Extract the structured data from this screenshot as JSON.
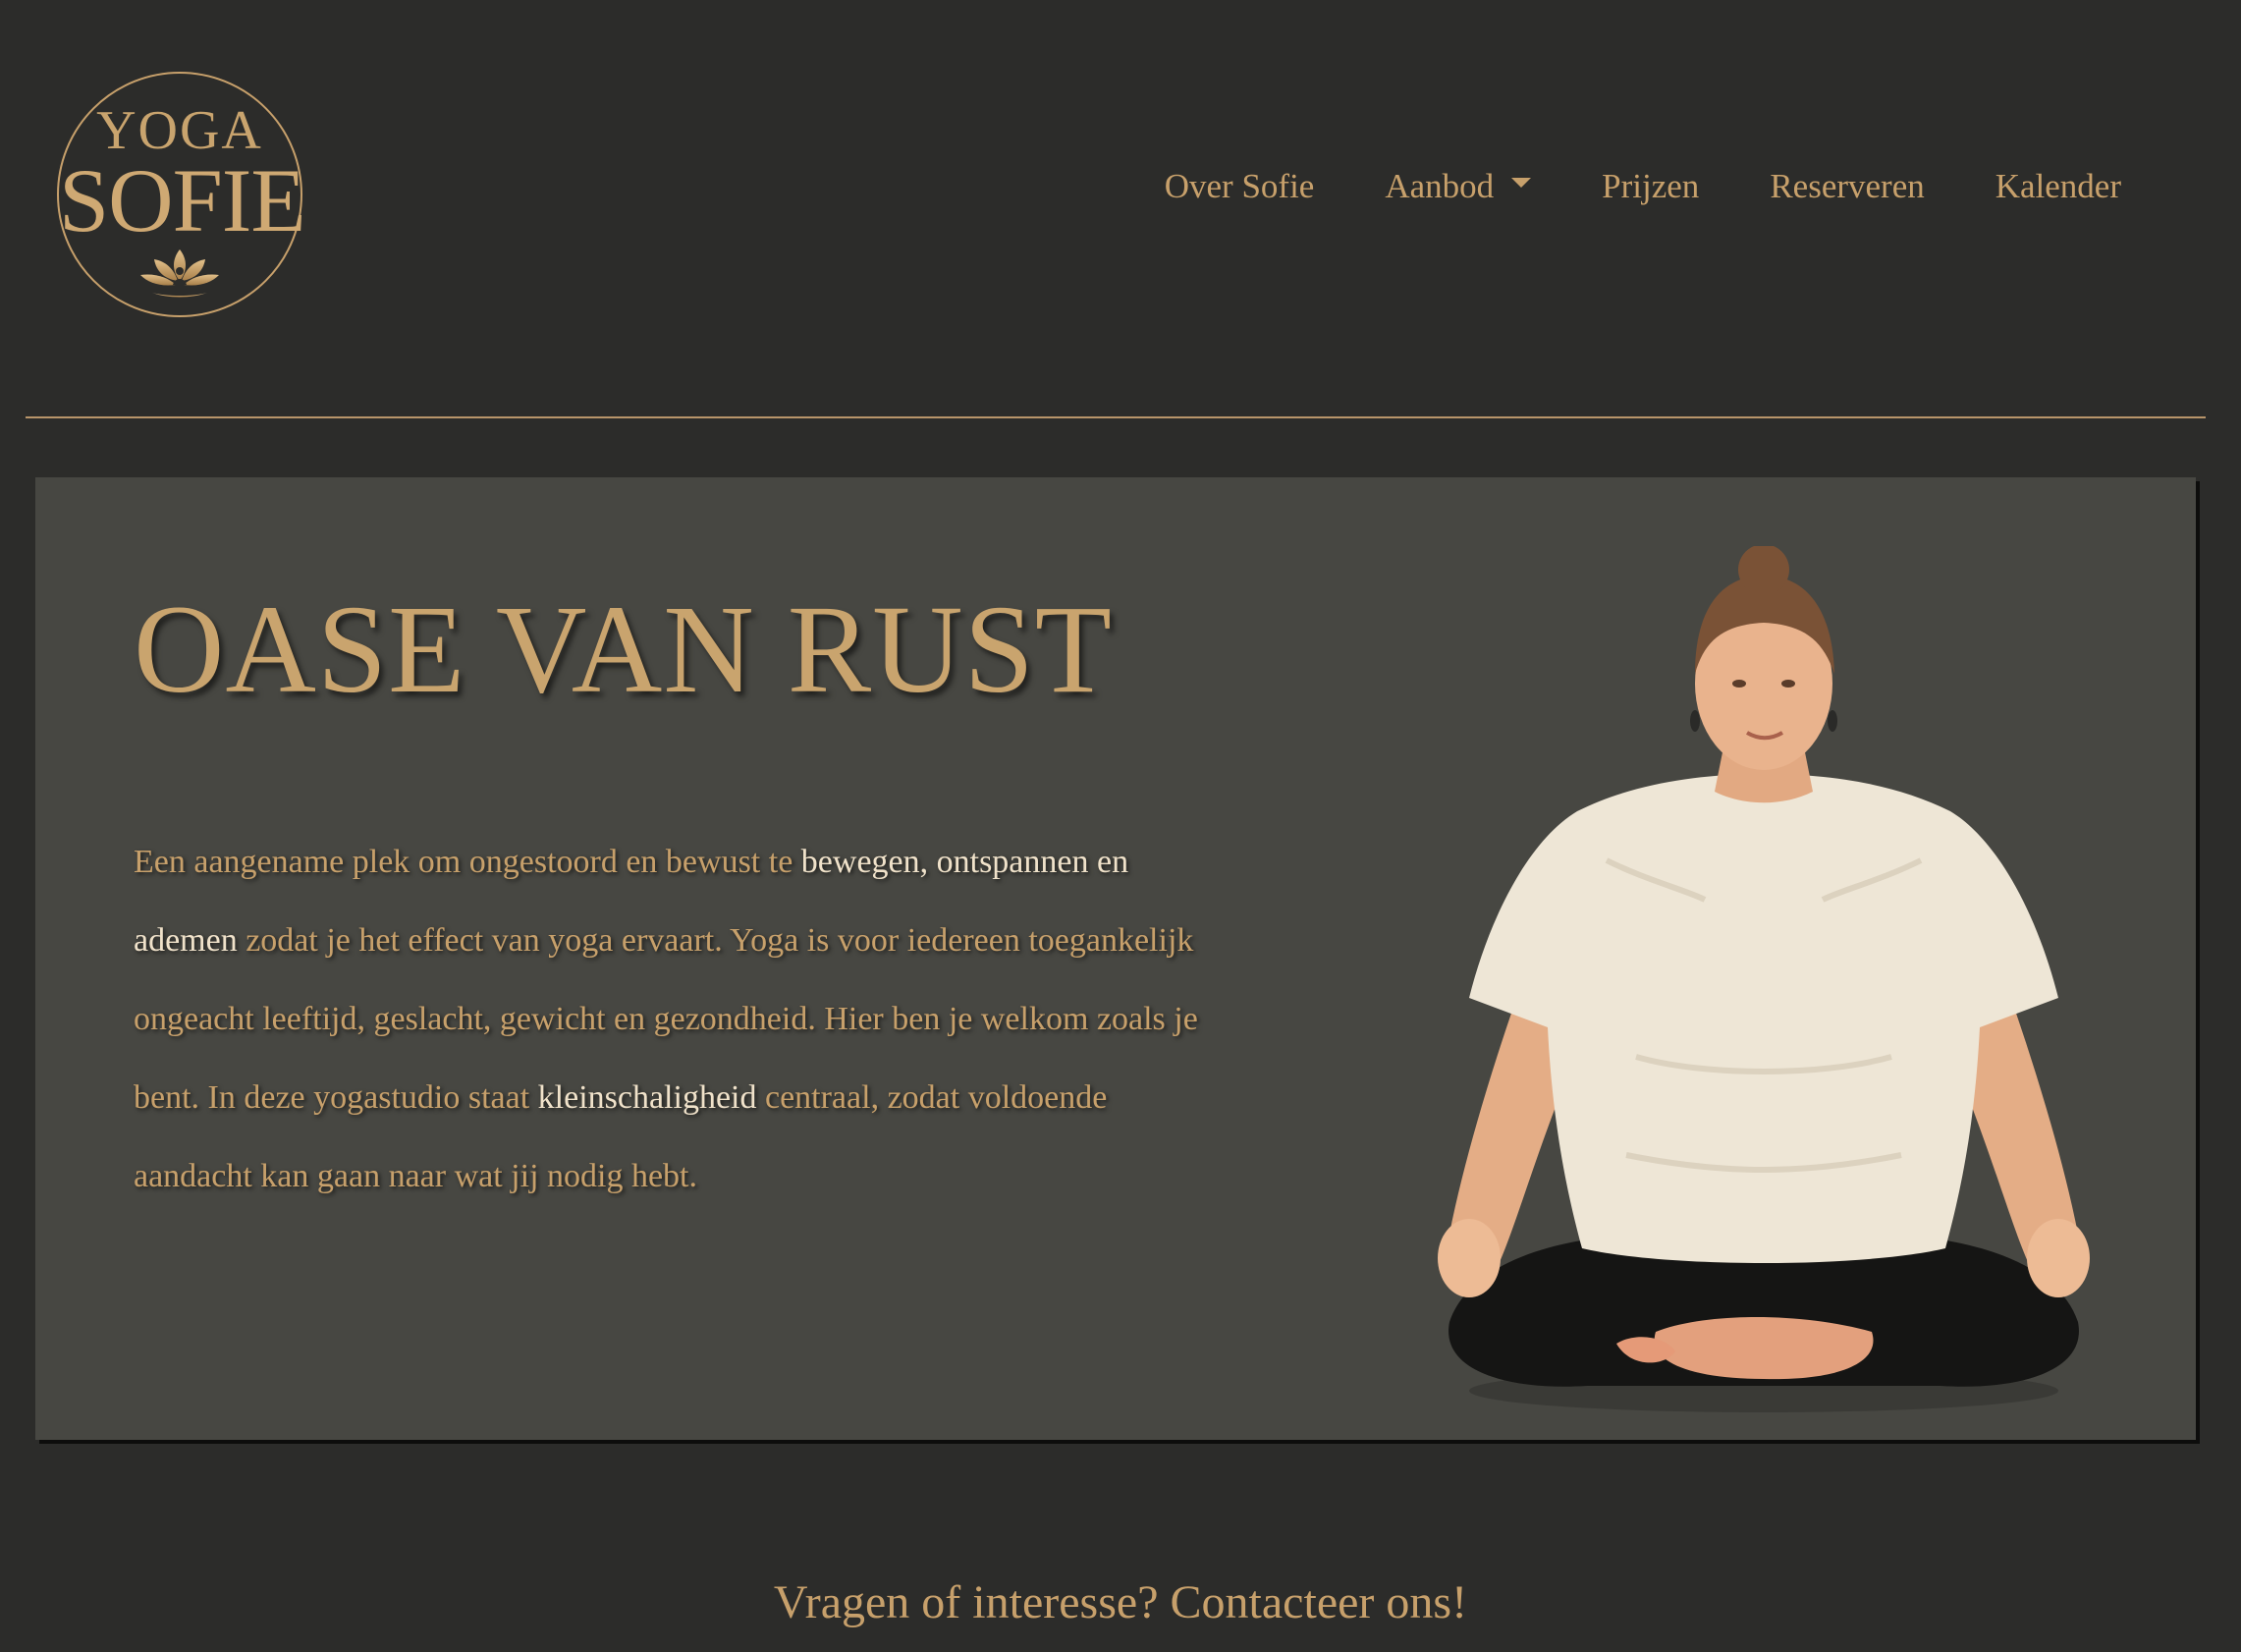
{
  "brand": {
    "logo_line1": "YOGA",
    "logo_line2": "SOFIE",
    "logo_mark_icon": "lotus-buddha-icon"
  },
  "nav": {
    "items": [
      {
        "label": "Over Sofie"
      },
      {
        "label": "Aanbod",
        "dropdown": true
      },
      {
        "label": "Prijzen"
      },
      {
        "label": "Reserveren"
      },
      {
        "label": "Kalender"
      }
    ]
  },
  "hero": {
    "title": "OASE VAN RUST",
    "body": {
      "p1": "Een aangename plek om ongestoord en bewust te ",
      "h1": "bewegen, ontspannen en ademen",
      "p2": " zodat je het effect van yoga ervaart. Yoga is voor iedereen toegankelijk ongeacht leeftijd, geslacht, gewicht en gezondheid. Hier ben je welkom zoals je bent. In deze yogastudio staat ",
      "h2": "kleinschaligheid",
      "p3": " centraal, zodat voldoende aandacht kan gaan naar wat jij nodig hebt."
    },
    "photo_icon": "meditating-woman-photo"
  },
  "cta": {
    "text": "Vragen of interesse? Contacteer ons!"
  },
  "colors": {
    "background": "#2c2c2a",
    "card": "#474742",
    "gold": "#c7a06b",
    "highlight": "#f0e2ca"
  }
}
